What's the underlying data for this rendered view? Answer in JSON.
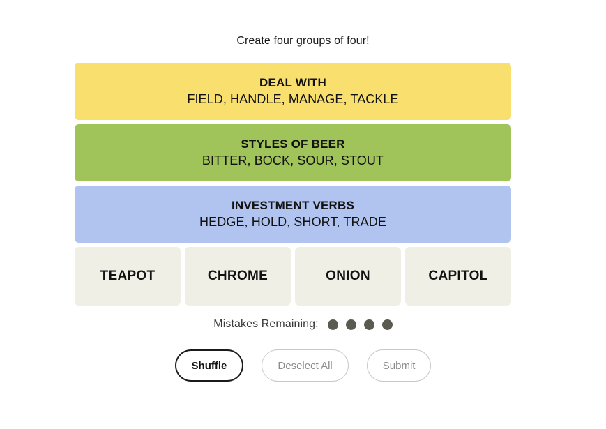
{
  "instruction": "Create four groups of four!",
  "colors": {
    "yellow": "#f9df6d",
    "green": "#a0c35a",
    "blue": "#b0c4ef",
    "tile": "#efefe6",
    "dot": "#5a5a51",
    "disabled_text": "#8c8c8c",
    "disabled_border": "#c8c8c8",
    "active_border": "#1a1a1a",
    "background": "#ffffff"
  },
  "solved_groups": [
    {
      "title": "DEAL WITH",
      "members": "FIELD, HANDLE, MANAGE, TACKLE",
      "color": "#f9df6d",
      "color_name": "yellow"
    },
    {
      "title": "STYLES OF BEER",
      "members": "BITTER, BOCK, SOUR, STOUT",
      "color": "#a0c35a",
      "color_name": "green"
    },
    {
      "title": "INVESTMENT VERBS",
      "members": "HEDGE, HOLD, SHORT, TRADE",
      "color": "#b0c4ef",
      "color_name": "blue"
    }
  ],
  "tiles": [
    {
      "word": "TEAPOT"
    },
    {
      "word": "CHROME"
    },
    {
      "word": "ONION"
    },
    {
      "word": "CAPITOL"
    }
  ],
  "mistakes": {
    "label": "Mistakes Remaining:",
    "remaining": 4,
    "dots": [
      1,
      2,
      3,
      4
    ]
  },
  "buttons": {
    "shuffle": {
      "label": "Shuffle",
      "enabled": true
    },
    "deselect_all": {
      "label": "Deselect All",
      "enabled": false
    },
    "submit": {
      "label": "Submit",
      "enabled": false
    }
  }
}
